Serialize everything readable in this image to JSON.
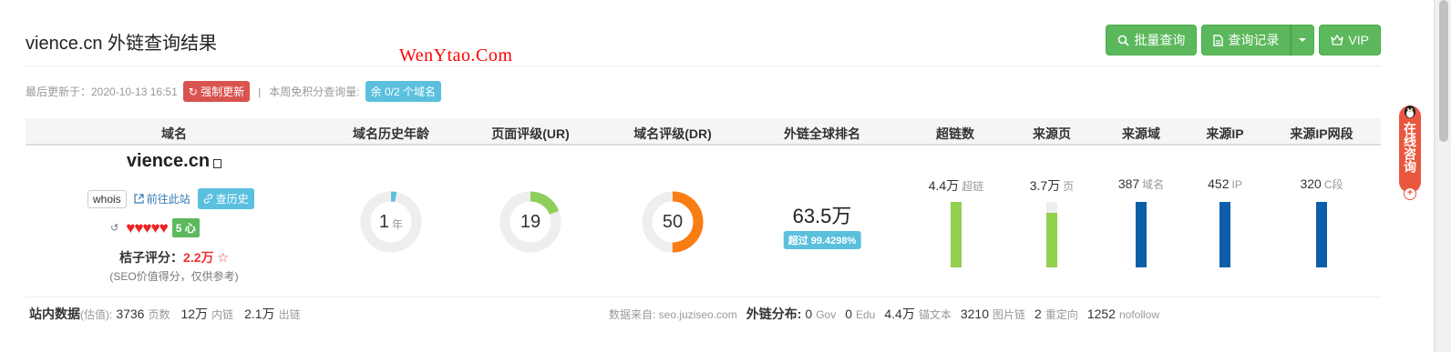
{
  "page": {
    "title": "vience.cn 外链查询结果",
    "watermark": "WenYtao.Com"
  },
  "toolbar": {
    "batch_label": "批量查询",
    "history_label": "查询记录",
    "vip_label": "VIP"
  },
  "meta": {
    "updated_prefix": "最后更新于：2020-10-13 16:51",
    "force_update_label": "强制更新",
    "separator": "|",
    "quota_prefix": "本周免积分查询量:",
    "quota_badge": "余 0/2 个域名"
  },
  "table": {
    "headers": [
      "域名",
      "域名历史年龄",
      "页面评级(UR)",
      "域名评级(DR)",
      "外链全球排名",
      "超链数",
      "来源页",
      "来源域",
      "来源IP",
      "来源IP网段"
    ]
  },
  "domain": {
    "name": "vience.cn",
    "whois_label": "whois",
    "visit_label": "前往此站",
    "history_label": "查历史",
    "hearts": "♥♥♥♥♥",
    "level_badge": "5 心",
    "score_label": "桔子评分：",
    "score_value": "2.2万",
    "score_star": "☆",
    "score_note": "(SEO价值得分，仅供参考)"
  },
  "metrics": {
    "age": {
      "value": "1",
      "unit": "年",
      "fraction": 0.03,
      "color": "#5bc0de"
    },
    "ur": {
      "value": "19",
      "fraction": 0.19,
      "color": "#8fce5b"
    },
    "dr": {
      "value": "50",
      "fraction": 0.5,
      "color": "#f97d14"
    },
    "rank": {
      "value": "63.5万",
      "badge": "超过 99.4298%"
    }
  },
  "bars": [
    {
      "value": "4.4万",
      "unit": "超链",
      "fraction": 1.0,
      "color": "#92d050"
    },
    {
      "value": "3.7万",
      "unit": "页",
      "fraction": 0.84,
      "color": "#92d050"
    },
    {
      "value": "387",
      "unit": "域名",
      "fraction": 1.0,
      "color": "#0d5ea8"
    },
    {
      "value": "452",
      "unit": "IP",
      "fraction": 1.0,
      "color": "#0d5ea8"
    },
    {
      "value": "320",
      "unit": "C段",
      "fraction": 1.0,
      "color": "#0d5ea8"
    }
  ],
  "footer": {
    "site_label": "站内数据",
    "site_est": "(估值):",
    "pages_value": "3736",
    "pages_unit": "页数",
    "inner_value": "12万",
    "inner_unit": "内链",
    "outer_value": "2.1万",
    "outer_unit": "出链",
    "source_text": "数据来自: seo.juziseo.com",
    "dist_label": "外链分布:",
    "gov_value": "0",
    "gov_unit": "Gov",
    "edu_value": "0",
    "edu_unit": "Edu",
    "anchor_value": "4.4万",
    "anchor_unit": "锚文本",
    "img_value": "3210",
    "img_unit": "图片链",
    "redirect_value": "2",
    "redirect_unit": "重定向",
    "nofollow_value": "1252",
    "nofollow_unit": "nofollow"
  },
  "float": {
    "consult_text": "在线咨询",
    "plus": "+"
  },
  "colors": {
    "green": "#5cb85c",
    "red": "#d9534f",
    "info": "#5bc0de",
    "bar_green": "#92d050",
    "bar_blue": "#0d5ea8",
    "consult": "#e9573f"
  }
}
